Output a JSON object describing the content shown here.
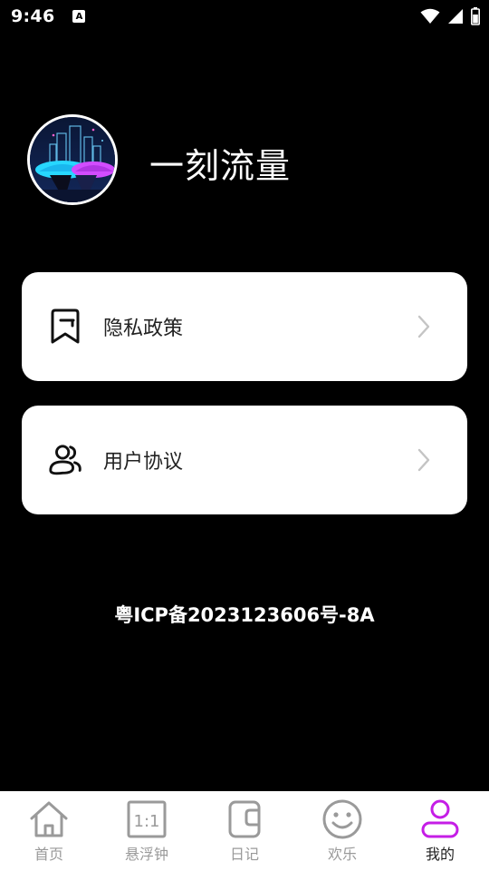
{
  "status_bar": {
    "time": "9:46",
    "notification_icon_letter": "A",
    "icons": [
      "wifi-icon",
      "signal-icon",
      "battery-icon"
    ]
  },
  "profile": {
    "app_name": "一刻流量"
  },
  "menu": [
    {
      "label": "隐私政策",
      "icon": "bookmark-icon"
    },
    {
      "label": "用户协议",
      "icon": "users-icon"
    }
  ],
  "footer": {
    "icp": "粤ICP备2023123606号-8A"
  },
  "bottom_nav": {
    "items": [
      {
        "label": "首页",
        "icon": "home-icon"
      },
      {
        "label": "悬浮钟",
        "icon": "ratio-icon",
        "icon_text": "1:1"
      },
      {
        "label": "日记",
        "icon": "diary-icon"
      },
      {
        "label": "欢乐",
        "icon": "smile-icon"
      },
      {
        "label": "我的",
        "icon": "user-icon",
        "active": true
      }
    ]
  },
  "colors": {
    "background": "#000000",
    "card": "#ffffff",
    "active_accent": "#c51ee6",
    "inactive": "#9a9a9a"
  }
}
